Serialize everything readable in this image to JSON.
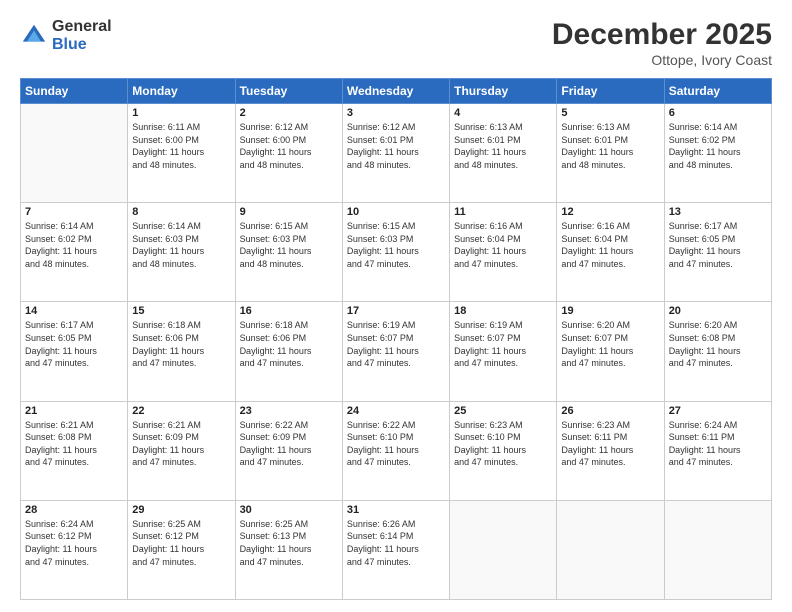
{
  "logo": {
    "line1": "General",
    "line2": "Blue"
  },
  "title": "December 2025",
  "subtitle": "Ottope, Ivory Coast",
  "days_header": [
    "Sunday",
    "Monday",
    "Tuesday",
    "Wednesday",
    "Thursday",
    "Friday",
    "Saturday"
  ],
  "weeks": [
    [
      {
        "num": "",
        "info": ""
      },
      {
        "num": "1",
        "info": "Sunrise: 6:11 AM\nSunset: 6:00 PM\nDaylight: 11 hours\nand 48 minutes."
      },
      {
        "num": "2",
        "info": "Sunrise: 6:12 AM\nSunset: 6:00 PM\nDaylight: 11 hours\nand 48 minutes."
      },
      {
        "num": "3",
        "info": "Sunrise: 6:12 AM\nSunset: 6:01 PM\nDaylight: 11 hours\nand 48 minutes."
      },
      {
        "num": "4",
        "info": "Sunrise: 6:13 AM\nSunset: 6:01 PM\nDaylight: 11 hours\nand 48 minutes."
      },
      {
        "num": "5",
        "info": "Sunrise: 6:13 AM\nSunset: 6:01 PM\nDaylight: 11 hours\nand 48 minutes."
      },
      {
        "num": "6",
        "info": "Sunrise: 6:14 AM\nSunset: 6:02 PM\nDaylight: 11 hours\nand 48 minutes."
      }
    ],
    [
      {
        "num": "7",
        "info": "Sunrise: 6:14 AM\nSunset: 6:02 PM\nDaylight: 11 hours\nand 48 minutes."
      },
      {
        "num": "8",
        "info": "Sunrise: 6:14 AM\nSunset: 6:03 PM\nDaylight: 11 hours\nand 48 minutes."
      },
      {
        "num": "9",
        "info": "Sunrise: 6:15 AM\nSunset: 6:03 PM\nDaylight: 11 hours\nand 48 minutes."
      },
      {
        "num": "10",
        "info": "Sunrise: 6:15 AM\nSunset: 6:03 PM\nDaylight: 11 hours\nand 47 minutes."
      },
      {
        "num": "11",
        "info": "Sunrise: 6:16 AM\nSunset: 6:04 PM\nDaylight: 11 hours\nand 47 minutes."
      },
      {
        "num": "12",
        "info": "Sunrise: 6:16 AM\nSunset: 6:04 PM\nDaylight: 11 hours\nand 47 minutes."
      },
      {
        "num": "13",
        "info": "Sunrise: 6:17 AM\nSunset: 6:05 PM\nDaylight: 11 hours\nand 47 minutes."
      }
    ],
    [
      {
        "num": "14",
        "info": "Sunrise: 6:17 AM\nSunset: 6:05 PM\nDaylight: 11 hours\nand 47 minutes."
      },
      {
        "num": "15",
        "info": "Sunrise: 6:18 AM\nSunset: 6:06 PM\nDaylight: 11 hours\nand 47 minutes."
      },
      {
        "num": "16",
        "info": "Sunrise: 6:18 AM\nSunset: 6:06 PM\nDaylight: 11 hours\nand 47 minutes."
      },
      {
        "num": "17",
        "info": "Sunrise: 6:19 AM\nSunset: 6:07 PM\nDaylight: 11 hours\nand 47 minutes."
      },
      {
        "num": "18",
        "info": "Sunrise: 6:19 AM\nSunset: 6:07 PM\nDaylight: 11 hours\nand 47 minutes."
      },
      {
        "num": "19",
        "info": "Sunrise: 6:20 AM\nSunset: 6:07 PM\nDaylight: 11 hours\nand 47 minutes."
      },
      {
        "num": "20",
        "info": "Sunrise: 6:20 AM\nSunset: 6:08 PM\nDaylight: 11 hours\nand 47 minutes."
      }
    ],
    [
      {
        "num": "21",
        "info": "Sunrise: 6:21 AM\nSunset: 6:08 PM\nDaylight: 11 hours\nand 47 minutes."
      },
      {
        "num": "22",
        "info": "Sunrise: 6:21 AM\nSunset: 6:09 PM\nDaylight: 11 hours\nand 47 minutes."
      },
      {
        "num": "23",
        "info": "Sunrise: 6:22 AM\nSunset: 6:09 PM\nDaylight: 11 hours\nand 47 minutes."
      },
      {
        "num": "24",
        "info": "Sunrise: 6:22 AM\nSunset: 6:10 PM\nDaylight: 11 hours\nand 47 minutes."
      },
      {
        "num": "25",
        "info": "Sunrise: 6:23 AM\nSunset: 6:10 PM\nDaylight: 11 hours\nand 47 minutes."
      },
      {
        "num": "26",
        "info": "Sunrise: 6:23 AM\nSunset: 6:11 PM\nDaylight: 11 hours\nand 47 minutes."
      },
      {
        "num": "27",
        "info": "Sunrise: 6:24 AM\nSunset: 6:11 PM\nDaylight: 11 hours\nand 47 minutes."
      }
    ],
    [
      {
        "num": "28",
        "info": "Sunrise: 6:24 AM\nSunset: 6:12 PM\nDaylight: 11 hours\nand 47 minutes."
      },
      {
        "num": "29",
        "info": "Sunrise: 6:25 AM\nSunset: 6:12 PM\nDaylight: 11 hours\nand 47 minutes."
      },
      {
        "num": "30",
        "info": "Sunrise: 6:25 AM\nSunset: 6:13 PM\nDaylight: 11 hours\nand 47 minutes."
      },
      {
        "num": "31",
        "info": "Sunrise: 6:26 AM\nSunset: 6:14 PM\nDaylight: 11 hours\nand 47 minutes."
      },
      {
        "num": "",
        "info": ""
      },
      {
        "num": "",
        "info": ""
      },
      {
        "num": "",
        "info": ""
      }
    ]
  ]
}
